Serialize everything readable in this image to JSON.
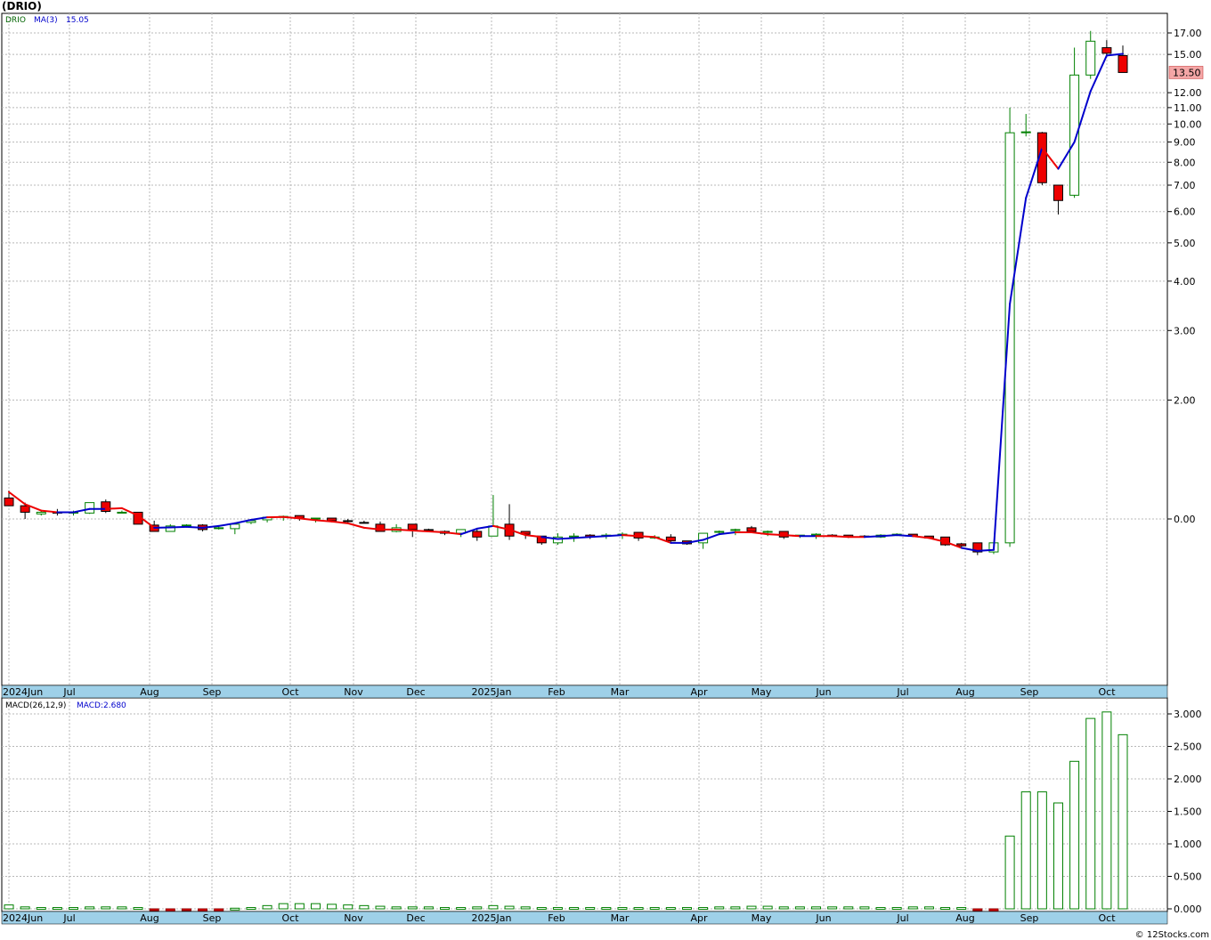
{
  "title": "(DRIO)",
  "credit": "© 12Stocks.com",
  "months": [
    "2024Jun",
    "Jul",
    "Aug",
    "Sep",
    "Oct",
    "Nov",
    "Dec",
    "2025Jan",
    "Feb",
    "Mar",
    "Apr",
    "May",
    "Jun",
    "Jul",
    "Aug",
    "Sep",
    "Oct"
  ],
  "chart_data": [
    {
      "type": "candlestick",
      "legend": {
        "symbol": "DRIO",
        "ma_label": "MA(3)",
        "ma_value": "15.05"
      },
      "y_scale": "log",
      "y_ticks": [
        {
          "v": 17,
          "label": "17.00"
        },
        {
          "v": 15,
          "label": "15.00"
        },
        {
          "v": 12,
          "label": "12.00"
        },
        {
          "v": 11,
          "label": "11.00"
        },
        {
          "v": 10,
          "label": "10.00"
        },
        {
          "v": 9,
          "label": "9.00"
        },
        {
          "v": 8,
          "label": "8.00"
        },
        {
          "v": 7,
          "label": "7.00"
        },
        {
          "v": 6,
          "label": "6.00"
        },
        {
          "v": 5,
          "label": "5.00"
        },
        {
          "v": 4,
          "label": "4.00"
        },
        {
          "v": 3,
          "label": "3.00"
        },
        {
          "v": 2,
          "label": "2.00"
        },
        {
          "v": 1,
          "label": "0.00"
        }
      ],
      "last_price_label": "13.50",
      "candles": [
        {
          "o": 1.13,
          "h": 1.18,
          "l": 1.08,
          "c": 1.08,
          "up": false
        },
        {
          "o": 1.08,
          "h": 1.1,
          "l": 1.0,
          "c": 1.04,
          "up": false
        },
        {
          "o": 1.03,
          "h": 1.05,
          "l": 1.02,
          "c": 1.04,
          "up": true
        },
        {
          "o": 1.04,
          "h": 1.06,
          "l": 1.02,
          "c": 1.04,
          "up": false
        },
        {
          "o": 1.04,
          "h": 1.05,
          "l": 1.02,
          "c": 1.04,
          "up": true
        },
        {
          "o": 1.035,
          "h": 1.1,
          "l": 1.03,
          "c": 1.1,
          "up": true
        },
        {
          "o": 1.105,
          "h": 1.12,
          "l": 1.035,
          "c": 1.045,
          "up": false
        },
        {
          "o": 1.04,
          "h": 1.05,
          "l": 1.035,
          "c": 1.04,
          "up": true
        },
        {
          "o": 1.04,
          "h": 1.04,
          "l": 0.97,
          "c": 0.97,
          "up": false
        },
        {
          "o": 0.965,
          "h": 0.99,
          "l": 0.93,
          "c": 0.93,
          "up": false
        },
        {
          "o": 0.93,
          "h": 0.97,
          "l": 0.93,
          "c": 0.96,
          "up": true
        },
        {
          "o": 0.96,
          "h": 0.97,
          "l": 0.955,
          "c": 0.965,
          "up": true
        },
        {
          "o": 0.965,
          "h": 0.97,
          "l": 0.93,
          "c": 0.94,
          "up": false
        },
        {
          "o": 0.95,
          "h": 0.96,
          "l": 0.94,
          "c": 0.95,
          "up": true
        },
        {
          "o": 0.945,
          "h": 0.98,
          "l": 0.915,
          "c": 0.97,
          "up": true
        },
        {
          "o": 0.98,
          "h": 0.995,
          "l": 0.97,
          "c": 0.99,
          "up": true
        },
        {
          "o": 0.995,
          "h": 1.01,
          "l": 0.98,
          "c": 1.01,
          "up": true
        },
        {
          "o": 1.01,
          "h": 1.02,
          "l": 0.99,
          "c": 1.015,
          "up": true
        },
        {
          "o": 1.02,
          "h": 1.02,
          "l": 0.99,
          "c": 1.005,
          "up": false
        },
        {
          "o": 1.0,
          "h": 1.005,
          "l": 0.98,
          "c": 1.005,
          "up": true
        },
        {
          "o": 1.005,
          "h": 1.005,
          "l": 0.985,
          "c": 0.99,
          "up": false
        },
        {
          "o": 0.99,
          "h": 1.0,
          "l": 0.98,
          "c": 0.985,
          "up": false
        },
        {
          "o": 0.98,
          "h": 0.99,
          "l": 0.975,
          "c": 0.975,
          "up": false
        },
        {
          "o": 0.97,
          "h": 0.985,
          "l": 0.93,
          "c": 0.93,
          "up": false
        },
        {
          "o": 0.93,
          "h": 0.97,
          "l": 0.925,
          "c": 0.95,
          "up": true
        },
        {
          "o": 0.97,
          "h": 0.97,
          "l": 0.9,
          "c": 0.94,
          "up": false
        },
        {
          "o": 0.94,
          "h": 0.945,
          "l": 0.93,
          "c": 0.94,
          "up": false
        },
        {
          "o": 0.93,
          "h": 0.935,
          "l": 0.91,
          "c": 0.92,
          "up": false
        },
        {
          "o": 0.92,
          "h": 0.94,
          "l": 0.9,
          "c": 0.94,
          "up": true
        },
        {
          "o": 0.93,
          "h": 0.94,
          "l": 0.88,
          "c": 0.9,
          "up": false
        },
        {
          "o": 0.905,
          "h": 1.15,
          "l": 0.905,
          "c": 0.96,
          "up": true
        },
        {
          "o": 0.97,
          "h": 1.09,
          "l": 0.885,
          "c": 0.905,
          "up": false
        },
        {
          "o": 0.93,
          "h": 0.93,
          "l": 0.89,
          "c": 0.915,
          "up": false
        },
        {
          "o": 0.905,
          "h": 0.905,
          "l": 0.86,
          "c": 0.87,
          "up": false
        },
        {
          "o": 0.87,
          "h": 0.92,
          "l": 0.86,
          "c": 0.9,
          "up": true
        },
        {
          "o": 0.9,
          "h": 0.92,
          "l": 0.875,
          "c": 0.905,
          "up": true
        },
        {
          "o": 0.91,
          "h": 0.915,
          "l": 0.89,
          "c": 0.9,
          "up": false
        },
        {
          "o": 0.91,
          "h": 0.92,
          "l": 0.89,
          "c": 0.91,
          "up": true
        },
        {
          "o": 0.915,
          "h": 0.925,
          "l": 0.89,
          "c": 0.915,
          "up": true
        },
        {
          "o": 0.925,
          "h": 0.925,
          "l": 0.88,
          "c": 0.895,
          "up": false
        },
        {
          "o": 0.895,
          "h": 0.91,
          "l": 0.89,
          "c": 0.9,
          "up": true
        },
        {
          "o": 0.9,
          "h": 0.915,
          "l": 0.87,
          "c": 0.88,
          "up": false
        },
        {
          "o": 0.88,
          "h": 0.88,
          "l": 0.86,
          "c": 0.865,
          "up": false
        },
        {
          "o": 0.87,
          "h": 0.92,
          "l": 0.84,
          "c": 0.92,
          "up": true
        },
        {
          "o": 0.925,
          "h": 0.935,
          "l": 0.91,
          "c": 0.93,
          "up": true
        },
        {
          "o": 0.935,
          "h": 0.945,
          "l": 0.91,
          "c": 0.94,
          "up": true
        },
        {
          "o": 0.95,
          "h": 0.96,
          "l": 0.925,
          "c": 0.93,
          "up": false
        },
        {
          "o": 0.93,
          "h": 0.935,
          "l": 0.905,
          "c": 0.925,
          "up": true
        },
        {
          "o": 0.93,
          "h": 0.93,
          "l": 0.89,
          "c": 0.9,
          "up": false
        },
        {
          "o": 0.905,
          "h": 0.91,
          "l": 0.895,
          "c": 0.91,
          "up": true
        },
        {
          "o": 0.91,
          "h": 0.92,
          "l": 0.89,
          "c": 0.915,
          "up": true
        },
        {
          "o": 0.91,
          "h": 0.915,
          "l": 0.9,
          "c": 0.91,
          "up": false
        },
        {
          "o": 0.91,
          "h": 0.91,
          "l": 0.895,
          "c": 0.9,
          "up": false
        },
        {
          "o": 0.905,
          "h": 0.91,
          "l": 0.9,
          "c": 0.905,
          "up": false
        },
        {
          "o": 0.9,
          "h": 0.915,
          "l": 0.895,
          "c": 0.91,
          "up": true
        },
        {
          "o": 0.91,
          "h": 0.92,
          "l": 0.905,
          "c": 0.915,
          "up": true
        },
        {
          "o": 0.915,
          "h": 0.915,
          "l": 0.9,
          "c": 0.905,
          "up": false
        },
        {
          "o": 0.905,
          "h": 0.905,
          "l": 0.89,
          "c": 0.895,
          "up": false
        },
        {
          "o": 0.9,
          "h": 0.9,
          "l": 0.855,
          "c": 0.86,
          "up": false
        },
        {
          "o": 0.865,
          "h": 0.87,
          "l": 0.85,
          "c": 0.855,
          "up": false
        },
        {
          "o": 0.87,
          "h": 0.87,
          "l": 0.81,
          "c": 0.825,
          "up": false
        },
        {
          "o": 0.825,
          "h": 0.87,
          "l": 0.815,
          "c": 0.87,
          "up": true
        },
        {
          "o": 0.87,
          "h": 11.0,
          "l": 0.85,
          "c": 9.5,
          "up": true
        },
        {
          "o": 9.5,
          "h": 10.6,
          "l": 9.3,
          "c": 9.55,
          "up": true
        },
        {
          "o": 9.5,
          "h": 9.55,
          "l": 7.0,
          "c": 7.1,
          "up": false
        },
        {
          "o": 7.0,
          "h": 7.0,
          "l": 5.9,
          "c": 6.4,
          "up": false
        },
        {
          "o": 6.6,
          "h": 15.6,
          "l": 6.5,
          "c": 13.3,
          "up": true
        },
        {
          "o": 13.3,
          "h": 17.2,
          "l": 13.0,
          "c": 16.2,
          "up": true
        },
        {
          "o": 15.6,
          "h": 16.3,
          "l": 14.8,
          "c": 15.1,
          "up": false
        },
        {
          "o": 14.9,
          "h": 15.8,
          "l": 13.5,
          "c": 13.5,
          "up": false
        }
      ],
      "ma": [
        1.17,
        1.09,
        1.05,
        1.04,
        1.04,
        1.06,
        1.06,
        1.065,
        1.02,
        0.95,
        0.952,
        0.955,
        0.95,
        0.96,
        0.975,
        0.995,
        1.01,
        1.012,
        1.003,
        0.993,
        0.985,
        0.975,
        0.95,
        0.94,
        0.94,
        0.935,
        0.93,
        0.925,
        0.915,
        0.945,
        0.96,
        0.94,
        0.91,
        0.9,
        0.89,
        0.895,
        0.9,
        0.905,
        0.91,
        0.905,
        0.9,
        0.87,
        0.87,
        0.885,
        0.915,
        0.925,
        0.925,
        0.915,
        0.91,
        0.905,
        0.905,
        0.905,
        0.9,
        0.9,
        0.905,
        0.91,
        0.905,
        0.895,
        0.875,
        0.845,
        0.83,
        0.835,
        3.5,
        6.5,
        8.7,
        7.7,
        9.0,
        12.1,
        14.9,
        15.05
      ],
      "ma_colors": [
        "#ee0000",
        "#ee0000",
        "#ee0000",
        "#ee0000",
        "#0000cc",
        "#0000cc",
        "#0000cc",
        "#ee0000",
        "#ee0000",
        "#ee0000",
        "#0000cc",
        "#0000cc",
        "#0000cc",
        "#0000cc",
        "#0000cc",
        "#0000cc",
        "#0000cc",
        "#ee0000",
        "#ee0000",
        "#ee0000",
        "#ee0000",
        "#ee0000",
        "#ee0000",
        "#ee0000",
        "#ee0000",
        "#ee0000",
        "#ee0000",
        "#ee0000",
        "#ee0000",
        "#0000cc",
        "#0000cc",
        "#ee0000",
        "#ee0000",
        "#ee0000",
        "#0000cc",
        "#0000cc",
        "#0000cc",
        "#0000cc",
        "#0000cc",
        "#ee0000",
        "#ee0000",
        "#ee0000",
        "#0000cc",
        "#0000cc",
        "#0000cc",
        "#0000cc",
        "#ee0000",
        "#ee0000",
        "#ee0000",
        "#ee0000",
        "#0000cc",
        "#ee0000",
        "#ee0000",
        "#ee0000",
        "#0000cc",
        "#0000cc",
        "#0000cc",
        "#ee0000",
        "#ee0000",
        "#ee0000",
        "#0000cc",
        "#0000cc",
        "#0000cc",
        "#0000cc",
        "#0000cc",
        "#ee0000",
        "#0000cc",
        "#0000cc",
        "#0000cc",
        "#0000cc"
      ]
    },
    {
      "type": "bar",
      "title": "MACD(26,12,9)",
      "value_label": "MACD:2.680",
      "y_ticks": [
        {
          "v": 3.0,
          "label": "3.000"
        },
        {
          "v": 2.5,
          "label": "2.500"
        },
        {
          "v": 2.0,
          "label": "2.000"
        },
        {
          "v": 1.5,
          "label": "1.500"
        },
        {
          "v": 1.0,
          "label": "1.000"
        },
        {
          "v": 0.5,
          "label": "0.500"
        },
        {
          "v": 0.0,
          "label": "0.000"
        }
      ],
      "values": [
        0.06,
        0.03,
        0.02,
        0.02,
        0.02,
        0.03,
        0.03,
        0.03,
        0.02,
        -0.02,
        -0.03,
        -0.02,
        -0.03,
        -0.03,
        0.01,
        0.02,
        0.05,
        0.08,
        0.08,
        0.08,
        0.07,
        0.06,
        0.05,
        0.04,
        0.03,
        0.03,
        0.03,
        0.02,
        0.02,
        0.03,
        0.05,
        0.04,
        0.03,
        0.02,
        0.02,
        0.02,
        0.02,
        0.02,
        0.02,
        0.02,
        0.02,
        0.02,
        0.02,
        0.02,
        0.03,
        0.03,
        0.04,
        0.04,
        0.03,
        0.03,
        0.03,
        0.03,
        0.03,
        0.03,
        0.02,
        0.02,
        0.03,
        0.03,
        0.02,
        0.02,
        -0.02,
        -0.03,
        1.12,
        1.8,
        1.8,
        1.63,
        2.27,
        2.93,
        3.03,
        2.68
      ]
    }
  ]
}
